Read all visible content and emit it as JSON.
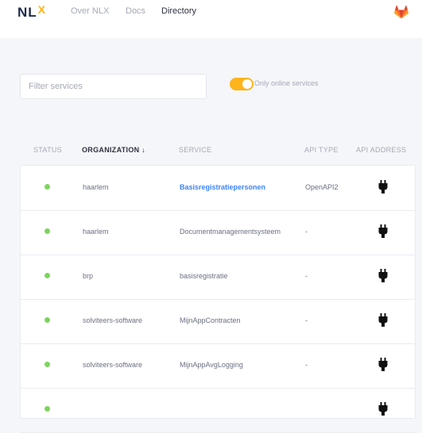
{
  "header": {
    "logo_text": "NL",
    "logo_mark": "X",
    "nav": [
      {
        "label": "Over NLX",
        "active": false
      },
      {
        "label": "Docs",
        "active": false
      },
      {
        "label": "Directory",
        "active": true
      }
    ],
    "repo_icon": "gitlab-icon"
  },
  "filters": {
    "search_placeholder": "Filter services",
    "search_value": "",
    "online_only_label": "Only online services",
    "online_only_checked": true
  },
  "table": {
    "columns": {
      "status": "STATUS",
      "organization": "ORGANIZATION ↓",
      "service": "SERVICE",
      "api_type": "API TYPE",
      "api_address": "API ADDRESS"
    },
    "rows": [
      {
        "status": "online",
        "organization": "haarlem",
        "service": "Basisregistratiepersonen",
        "api_type": "OpenAPI2",
        "highlighted": true
      },
      {
        "status": "online",
        "organization": "haarlem",
        "service": "Documentmanagementsysteem",
        "api_type": "-",
        "highlighted": false
      },
      {
        "status": "online",
        "organization": "brp",
        "service": "basisregistratie",
        "api_type": "-",
        "highlighted": false
      },
      {
        "status": "online",
        "organization": "solviteers-software",
        "service": "MijnAppContracten",
        "api_type": "-",
        "highlighted": false
      },
      {
        "status": "online",
        "organization": "solviteers-software",
        "service": "MijnAppAvgLogging",
        "api_type": "-",
        "highlighted": false
      },
      {
        "status": "online",
        "organization": "",
        "service": "",
        "api_type": "",
        "highlighted": false
      }
    ]
  },
  "colors": {
    "accent": "#feb41c",
    "link": "#3d83f7",
    "status_online": "#7dd45e",
    "brand_dark": "#1f2b4d"
  }
}
